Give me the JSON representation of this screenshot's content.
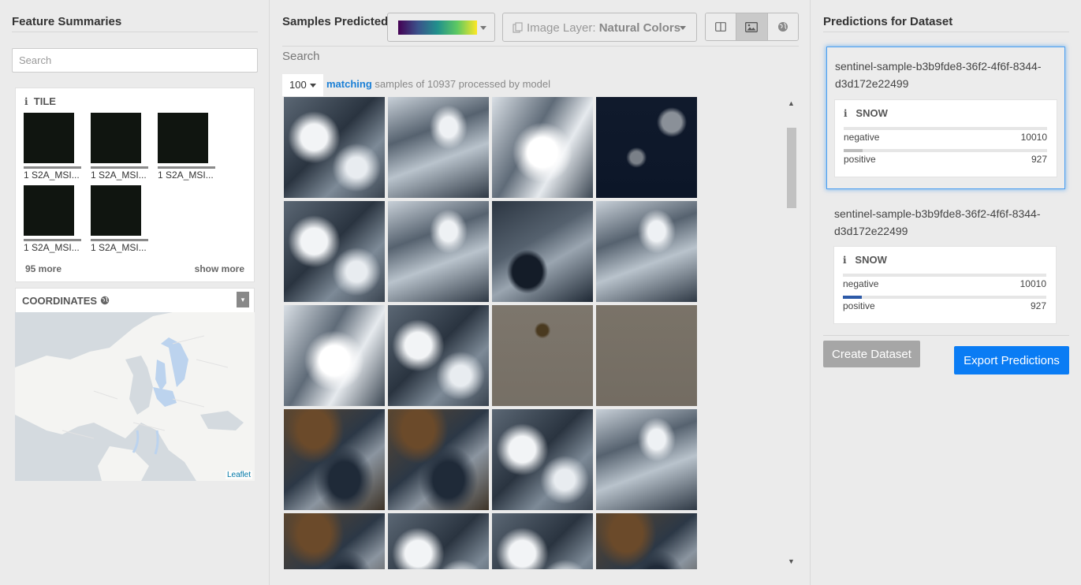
{
  "left": {
    "title": "Feature Summaries",
    "search_placeholder": "Search",
    "tile_card": {
      "heading": "TILE",
      "thumbs": [
        {
          "label": "1 S2A_MSI..."
        },
        {
          "label": "1 S2A_MSI..."
        },
        {
          "label": "1 S2A_MSI..."
        },
        {
          "label": "1 S2A_MSI..."
        },
        {
          "label": "1 S2A_MSI..."
        }
      ],
      "more_count": "95 more",
      "show_more": "show more"
    },
    "coordinates": {
      "heading": "COORDINATES",
      "icon": "globe-icon",
      "attribution": "Leaflet"
    }
  },
  "middle": {
    "title": "Samples Predicted",
    "colormap": "viridis",
    "image_layer": {
      "prefix": "Image Layer:",
      "value": "Natural Colors"
    },
    "view_buttons": [
      "split-view-icon",
      "image-view-icon",
      "globe-view-icon"
    ],
    "active_view": "image-view-icon",
    "search_label": "Search",
    "page_size": "100",
    "matching": {
      "keyword": "matching",
      "text": "samples of 10937 processed by model"
    },
    "tiles": [
      {
        "style": "snow-mountain"
      },
      {
        "style": "snow-ridge"
      },
      {
        "style": "snow-bright"
      },
      {
        "style": "dark-lake"
      },
      {
        "style": "snow-mountain"
      },
      {
        "style": "snow-ridge"
      },
      {
        "style": "dark-lake-snow"
      },
      {
        "style": "snow-ridge"
      },
      {
        "style": "snow-bright"
      },
      {
        "style": "snow-mountain"
      },
      {
        "style": "flat-brown-spot"
      },
      {
        "style": "flat-brown"
      },
      {
        "style": "brown-valley"
      },
      {
        "style": "brown-valley"
      },
      {
        "style": "snow-mountain"
      },
      {
        "style": "snow-ridge"
      },
      {
        "style": "brown-valley"
      },
      {
        "style": "snow-mountain"
      },
      {
        "style": "snow-mountain"
      },
      {
        "style": "brown-valley"
      }
    ]
  },
  "right": {
    "title": "Predictions for Dataset",
    "cards": [
      {
        "title": "sentinel-sample-b3b9fde8-36f2-4f6f-8344-d3d172e22499",
        "selected": true,
        "label": "SNOW",
        "rows": [
          {
            "name": "negative",
            "value": "10010",
            "fraction": 1.0,
            "color": "#e6e6e6"
          },
          {
            "name": "positive",
            "value": "927",
            "fraction": 0.093,
            "color": "#bdbdbd"
          }
        ]
      },
      {
        "title": "sentinel-sample-b3b9fde8-36f2-4f6f-8344-d3d172e22499",
        "selected": false,
        "label": "SNOW",
        "rows": [
          {
            "name": "negative",
            "value": "10010",
            "fraction": 1.0,
            "color": "#e6e6e6"
          },
          {
            "name": "positive",
            "value": "927",
            "fraction": 0.093,
            "color": "#2d5aa8"
          }
        ]
      }
    ],
    "create_label": "Create Dataset",
    "export_label": "Export Predictions"
  },
  "colors": {
    "accent": "#0a7cf4",
    "link": "#1a7fd6",
    "selected_border": "#4a9ef0"
  }
}
